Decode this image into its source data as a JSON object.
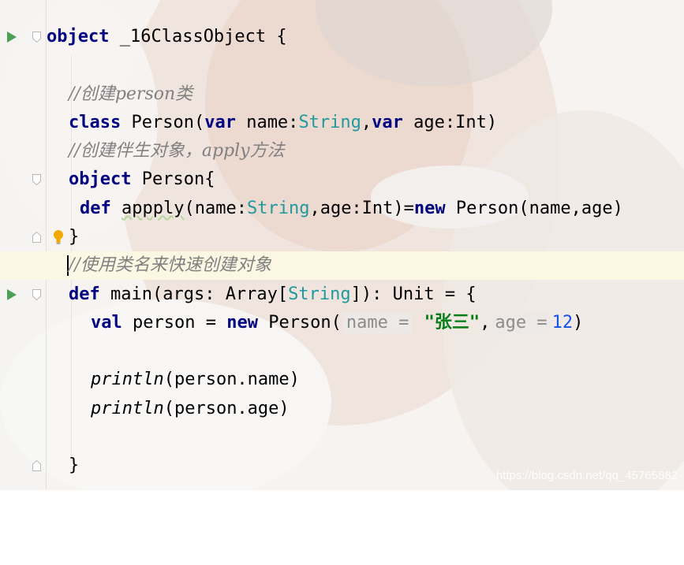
{
  "editor": {
    "lines": [
      {
        "tokens": [
          {
            "cls": "kw",
            "text": "object"
          },
          {
            "cls": "plain",
            "text": " _16ClassObject {"
          }
        ]
      },
      {
        "tokens": []
      },
      {
        "tokens": [
          {
            "cls": "cmt",
            "text": "//创建person类"
          }
        ]
      },
      {
        "tokens": [
          {
            "cls": "kw",
            "text": "class"
          },
          {
            "cls": "plain",
            "text": " Person("
          },
          {
            "cls": "kw",
            "text": "var"
          },
          {
            "cls": "plain",
            "text": " name:"
          },
          {
            "cls": "type",
            "text": "String"
          },
          {
            "cls": "plain",
            "text": ","
          },
          {
            "cls": "kw",
            "text": "var"
          },
          {
            "cls": "plain",
            "text": " age:Int)"
          }
        ]
      },
      {
        "tokens": [
          {
            "cls": "cmt",
            "text": "//创建伴生对象，apply方法"
          }
        ]
      },
      {
        "tokens": [
          {
            "cls": "kw",
            "text": "object"
          },
          {
            "cls": "plain",
            "text": " Person{"
          }
        ]
      },
      {
        "tokens": [
          {
            "cls": "kw",
            "text": "def"
          },
          {
            "cls": "plain",
            "text": " "
          },
          {
            "cls": "plain warn",
            "text": "appply"
          },
          {
            "cls": "plain",
            "text": "(name:"
          },
          {
            "cls": "type",
            "text": "String"
          },
          {
            "cls": "plain",
            "text": ",age:Int)="
          },
          {
            "cls": "kw",
            "text": "new"
          },
          {
            "cls": "plain",
            "text": " Person(name,age)"
          }
        ]
      },
      {
        "tokens": [
          {
            "cls": "plain",
            "text": "}"
          }
        ]
      },
      {
        "tokens": [
          {
            "cls": "cmt",
            "text": "//使用类名来快速创建对象"
          }
        ]
      },
      {
        "tokens": [
          {
            "cls": "kw",
            "text": "def"
          },
          {
            "cls": "plain",
            "text": " main(args: Array["
          },
          {
            "cls": "type",
            "text": "String"
          },
          {
            "cls": "plain",
            "text": "]): Unit = {"
          }
        ]
      },
      {
        "tokens": [
          {
            "cls": "kw",
            "text": "val"
          },
          {
            "cls": "plain",
            "text": " person = "
          },
          {
            "cls": "kw",
            "text": "new"
          },
          {
            "cls": "plain",
            "text": " Person("
          },
          {
            "cls": "hint",
            "text": "name ="
          },
          {
            "cls": "str",
            "text": " \"张三\""
          },
          {
            "cls": "plain",
            "text": ","
          },
          {
            "cls": "hint",
            "text": "age ="
          },
          {
            "cls": "num",
            "text": "12"
          },
          {
            "cls": "plain",
            "text": ")"
          }
        ]
      },
      {
        "tokens": []
      },
      {
        "tokens": [
          {
            "cls": "fn",
            "text": "println"
          },
          {
            "cls": "plain",
            "text": "(person.name)"
          }
        ]
      },
      {
        "tokens": [
          {
            "cls": "fn",
            "text": "println"
          },
          {
            "cls": "plain",
            "text": "(person.age)"
          }
        ]
      },
      {
        "tokens": []
      },
      {
        "tokens": [
          {
            "cls": "plain",
            "text": "}"
          }
        ]
      }
    ],
    "gutter_icons": {
      "run": "play-triangle-icon",
      "fold": "fold-marker-icon",
      "intention": "lightbulb-icon"
    }
  },
  "watermark": "https://blog.csdn.net/qq_45765882",
  "colors": {
    "keyword": "#000080",
    "type": "#20999d",
    "comment": "#808080",
    "string": "#067d17",
    "number": "#1750eb",
    "run_icon": "#4aa055",
    "current_line": "#fcf9e2"
  }
}
